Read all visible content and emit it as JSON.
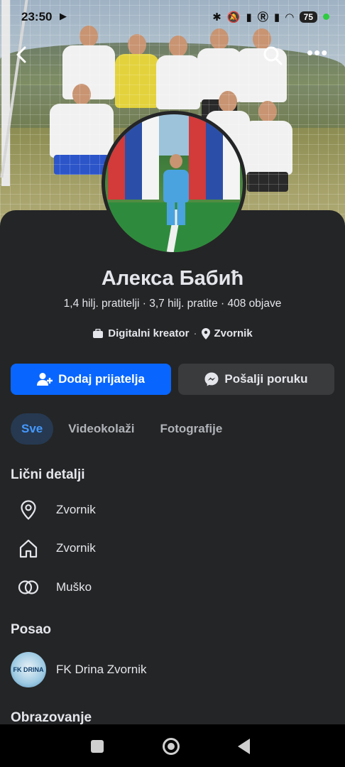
{
  "status_bar": {
    "time": "23:50",
    "battery": "75"
  },
  "profile": {
    "name": "Алекса Бабић",
    "stats": "1,4 hilj. pratitelji · 3,7 hilj. pratite · 408 objave",
    "category": "Digitalni kreator",
    "location": "Zvornik"
  },
  "actions": {
    "add_friend": "Dodaj prijatelja",
    "send_message": "Pošalji poruku"
  },
  "tabs": [
    {
      "label": "Sve",
      "active": true
    },
    {
      "label": "Videokolaži",
      "active": false
    },
    {
      "label": "Fotografije",
      "active": false
    }
  ],
  "details": {
    "title": "Lični detalji",
    "items": [
      {
        "icon": "location-pin-icon",
        "text": "Zvornik"
      },
      {
        "icon": "home-icon",
        "text": "Zvornik"
      },
      {
        "icon": "gender-rings-icon",
        "text": "Muško"
      }
    ]
  },
  "work": {
    "title": "Posao",
    "employer": "FK Drina Zvornik",
    "logo_text": "FK DRINA"
  },
  "education": {
    "title": "Obrazovanje"
  },
  "colors": {
    "background": "#242526",
    "primary_button": "#0866ff",
    "secondary_button": "#3a3b3c",
    "active_tab_bg": "#263951",
    "active_tab_text": "#4599ff"
  }
}
